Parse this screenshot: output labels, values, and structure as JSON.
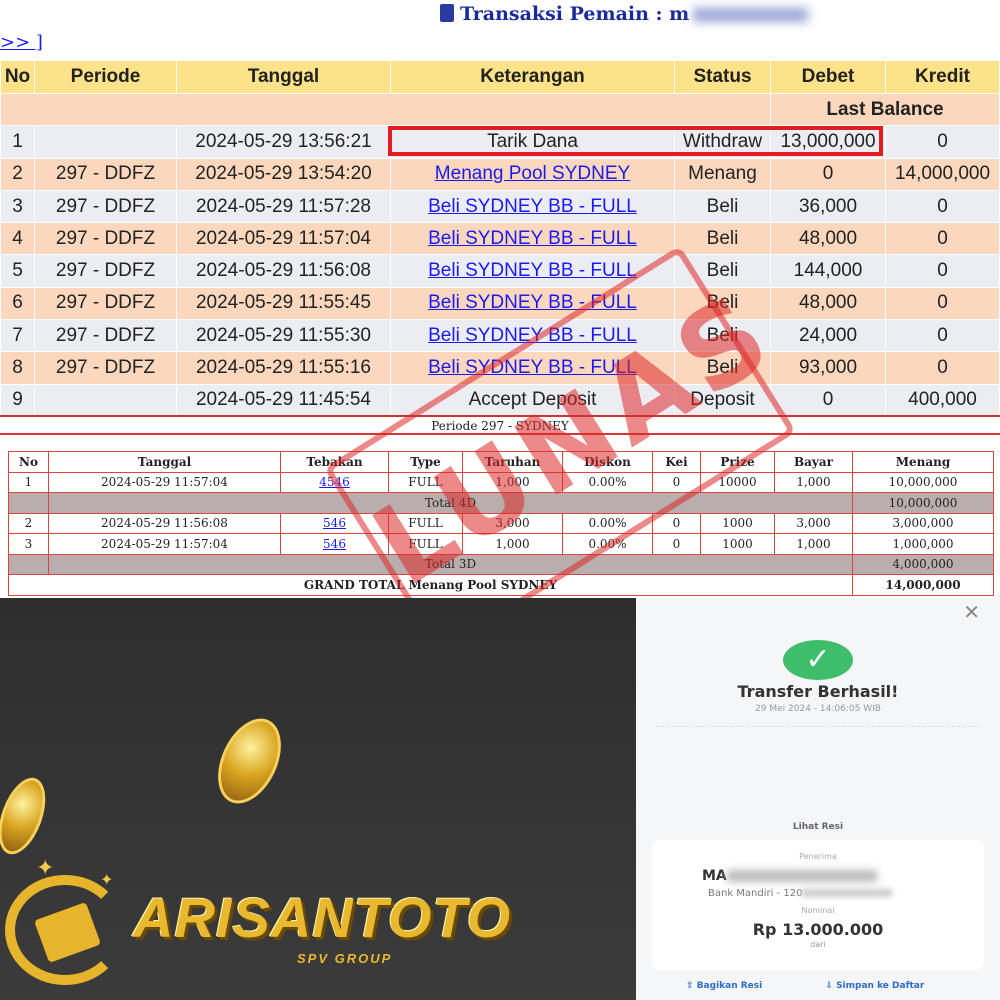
{
  "header": {
    "title": "Transaksi   Pemain : m"
  },
  "nav": {
    "next": ">> ]"
  },
  "transactions": {
    "columns": [
      "No",
      "Periode",
      "Tanggal",
      "Keterangan",
      "Status",
      "Debet",
      "Kredit"
    ],
    "last_balance": "Last Balance",
    "rows": [
      {
        "no": "1",
        "periode": "",
        "tanggal": "2024-05-29 13:56:21",
        "keterangan": "Tarik Dana",
        "status": "Withdraw",
        "debet": "13,000,000",
        "kredit": "0"
      },
      {
        "no": "2",
        "periode": "297 - DDFZ",
        "tanggal": "2024-05-29 13:54:20",
        "keterangan": "Menang Pool SYDNEY",
        "status": "Menang",
        "debet": "0",
        "kredit": "14,000,000"
      },
      {
        "no": "3",
        "periode": "297 - DDFZ",
        "tanggal": "2024-05-29 11:57:28",
        "keterangan": "Beli SYDNEY BB - FULL",
        "status": "Beli",
        "debet": "36,000",
        "kredit": "0"
      },
      {
        "no": "4",
        "periode": "297 - DDFZ",
        "tanggal": "2024-05-29 11:57:04",
        "keterangan": "Beli SYDNEY BB - FULL",
        "status": "Beli",
        "debet": "48,000",
        "kredit": "0"
      },
      {
        "no": "5",
        "periode": "297 - DDFZ",
        "tanggal": "2024-05-29 11:56:08",
        "keterangan": "Beli SYDNEY BB - FULL",
        "status": "Beli",
        "debet": "144,000",
        "kredit": "0"
      },
      {
        "no": "6",
        "periode": "297 - DDFZ",
        "tanggal": "2024-05-29 11:55:45",
        "keterangan": "Beli SYDNEY BB - FULL",
        "status": "Beli",
        "debet": "48,000",
        "kredit": "0"
      },
      {
        "no": "7",
        "periode": "297 - DDFZ",
        "tanggal": "2024-05-29 11:55:30",
        "keterangan": "Beli SYDNEY BB - FULL",
        "status": "Beli",
        "debet": "24,000",
        "kredit": "0"
      },
      {
        "no": "8",
        "periode": "297 - DDFZ",
        "tanggal": "2024-05-29 11:55:16",
        "keterangan": "Beli SYDNEY BB - FULL",
        "status": "Beli",
        "debet": "93,000",
        "kredit": "0"
      },
      {
        "no": "9",
        "periode": "",
        "tanggal": "2024-05-29 11:45:54",
        "keterangan": "Accept Deposit",
        "status": "Deposit",
        "debet": "0",
        "kredit": "400,000"
      }
    ]
  },
  "detail": {
    "periode_title": "Periode 297 - SYDNEY",
    "columns": [
      "No",
      "Tanggal",
      "Tebakan",
      "Type",
      "Taruhan",
      "Diskon",
      "Kei",
      "Prize",
      "Bayar",
      "Menang"
    ],
    "rows": [
      {
        "no": "1",
        "tanggal": "2024-05-29 11:57:04",
        "tebakan": "4546",
        "type": "FULL",
        "taruhan": "1,000",
        "diskon": "0.00%",
        "kei": "0",
        "prize": "10000",
        "bayar": "1,000",
        "menang": "10,000,000"
      },
      {
        "no": "2",
        "tanggal": "2024-05-29 11:56:08",
        "tebakan": "546",
        "type": "FULL",
        "taruhan": "3,000",
        "diskon": "0.00%",
        "kei": "0",
        "prize": "1000",
        "bayar": "3,000",
        "menang": "3,000,000"
      },
      {
        "no": "3",
        "tanggal": "2024-05-29 11:57:04",
        "tebakan": "546",
        "type": "FULL",
        "taruhan": "1,000",
        "diskon": "0.00%",
        "kei": "0",
        "prize": "1000",
        "bayar": "1,000",
        "menang": "1,000,000"
      }
    ],
    "total_4d_label": "Total 4D",
    "total_4d": "10,000,000",
    "total_3d_label": "Total 3D",
    "total_3d": "4,000,000",
    "grand_total_label": "GRAND TOTAL  Menang Pool SYDNEY",
    "grand_total": "14,000,000"
  },
  "stamp": "LUNAS",
  "logo": {
    "name": "ARISANTOTO",
    "tagline": "SPV GROUP"
  },
  "receipt": {
    "close": "✕",
    "check": "✓",
    "title": "Transfer Berhasil!",
    "datetime": "29 Mei 2024 - 14:06:05 WIB",
    "lihat_resi": "Lihat Resi",
    "penerima_label": "Penerima",
    "recipient_prefix": "MA",
    "bank": "Bank Mandiri - 120",
    "nominal_label": "Nominal",
    "amount": "Rp 13.000.000",
    "from_prefix": "dari",
    "share": "Bagikan Resi",
    "save": "Simpan ke Daftar"
  },
  "colors": {
    "header_yellow": "#fce38a",
    "row_peach": "#fbd8bd",
    "row_grey": "#ecedf3",
    "highlight_red": "#e31b23",
    "success_green": "#3ebd6a",
    "logo_gold": "#e8b82e"
  }
}
